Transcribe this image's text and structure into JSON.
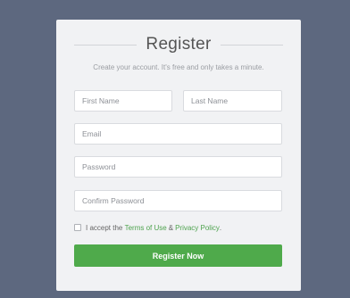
{
  "form": {
    "title": "Register",
    "subtitle": "Create your account. It's free and only takes a minute.",
    "fields": {
      "first_name": {
        "placeholder": "First Name",
        "value": ""
      },
      "last_name": {
        "placeholder": "Last Name",
        "value": ""
      },
      "email": {
        "placeholder": "Email",
        "value": ""
      },
      "password": {
        "placeholder": "Password",
        "value": ""
      },
      "confirm_password": {
        "placeholder": "Confirm Password",
        "value": ""
      }
    },
    "terms": {
      "prefix": "I accept the",
      "terms_link": "Terms of Use",
      "joiner": "&",
      "privacy_link": "Privacy Policy",
      "suffix": ".",
      "checked": false
    },
    "submit_label": "Register Now"
  },
  "colors": {
    "background": "#5d687f",
    "card": "#f1f2f4",
    "accent": "#4faa4b",
    "link": "#4ea34e"
  }
}
